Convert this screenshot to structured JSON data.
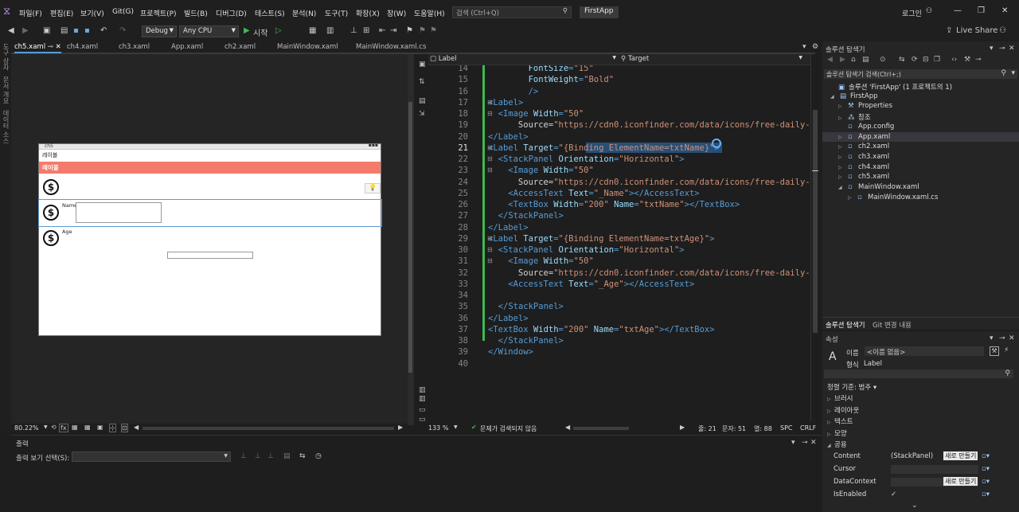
{
  "titlebar": {
    "menus": [
      "파일(F)",
      "편집(E)",
      "보기(V)",
      "Git(G)",
      "프로젝트(P)",
      "빌드(B)",
      "디버그(D)",
      "테스트(S)",
      "분석(N)",
      "도구(T)",
      "확장(X)",
      "창(W)",
      "도움말(H)"
    ],
    "search_placeholder": "검색 (Ctrl+Q)",
    "app_title": "FirstApp",
    "login": "로그인",
    "live_share": "Live Share"
  },
  "toolbar": {
    "config": "Debug",
    "platform": "Any CPU",
    "start_label": "시작"
  },
  "left_strip": [
    "도구 상자",
    "문서 개요",
    "데이터 소스"
  ],
  "doc_tabs": [
    "ch5.xaml",
    "ch4.xaml",
    "ch3.xaml",
    "App.xaml",
    "ch2.xaml",
    "MainWindow.xaml",
    "MainWindow.xaml.cs"
  ],
  "designer": {
    "window_title": "ch5",
    "label_text": "레이블",
    "header_text": "레이블",
    "name_label": "Name",
    "age_label": "Age",
    "zoom": "80.22%"
  },
  "editor": {
    "element_combo": "Label",
    "target_combo": "Target",
    "zoom": "133 %",
    "status_ok": "문제가 검색되지 않음",
    "line": "줄: 21",
    "col": "문자: 51",
    "col2": "열: 88",
    "spc": "SPC",
    "crlf": "CRLF",
    "lines": [
      {
        "n": "14",
        "code": "            FontSize=\"15\""
      },
      {
        "n": "15",
        "code": "            FontWeight=\"Bold\""
      },
      {
        "n": "16",
        "code": "            />"
      },
      {
        "n": "17",
        "code": "    <Label>"
      },
      {
        "n": "18",
        "code": "      <Image Width=\"50\""
      },
      {
        "n": "19",
        "code": "          Source=\"https://cdn0.iconfinder.com/data/icons/free-daily-icon"
      },
      {
        "n": "20",
        "code": "    </Label>"
      },
      {
        "n": "21",
        "code": "    <Label Target=\"{Binding ElementName=txtName}\">"
      },
      {
        "n": "22",
        "code": "      <StackPanel Orientation=\"Horizontal\">"
      },
      {
        "n": "23",
        "code": "        <Image Width=\"50\""
      },
      {
        "n": "24",
        "code": "          Source=\"https://cdn0.iconfinder.com/data/icons/free-daily-icon"
      },
      {
        "n": "25",
        "code": "        <AccessText Text=\"_Name\"></AccessText>"
      },
      {
        "n": "26",
        "code": "        <TextBox Width=\"200\" Name=\"txtName\"></TextBox>"
      },
      {
        "n": "27",
        "code": "      </StackPanel>"
      },
      {
        "n": "28",
        "code": "    </Label>"
      },
      {
        "n": "29",
        "code": "    <Label Target=\"{Binding ElementName=txtAge}\">"
      },
      {
        "n": "30",
        "code": "      <StackPanel Orientation=\"Horizontal\">"
      },
      {
        "n": "31",
        "code": "        <Image Width=\"50\""
      },
      {
        "n": "32",
        "code": "          Source=\"https://cdn0.iconfinder.com/data/icons/free-daily-icon"
      },
      {
        "n": "33",
        "code": "        <AccessText Text=\"_Age\"></AccessText>"
      },
      {
        "n": "34",
        "code": ""
      },
      {
        "n": "35",
        "code": "      </StackPanel>"
      },
      {
        "n": "36",
        "code": "    </Label>"
      },
      {
        "n": "37",
        "code": "    <TextBox Width=\"200\" Name=\"txtAge\"></TextBox>"
      },
      {
        "n": "38",
        "code": "  </StackPanel>"
      },
      {
        "n": "39",
        "code": "</Window>"
      },
      {
        "n": "40",
        "code": ""
      }
    ]
  },
  "solution": {
    "panel_title": "솔루션 탐색기",
    "search": "솔루션 탐색기 검색(Ctrl+;)",
    "items": [
      {
        "text": "솔루션 'FirstApp' (1 프로젝트의 1)"
      },
      {
        "text": "FirstApp"
      },
      {
        "text": "Properties"
      },
      {
        "text": "참조"
      },
      {
        "text": "App.config"
      },
      {
        "text": "App.xaml"
      },
      {
        "text": "ch2.xaml"
      },
      {
        "text": "ch3.xaml"
      },
      {
        "text": "ch4.xaml"
      },
      {
        "text": "ch5.xaml"
      },
      {
        "text": "MainWindow.xaml"
      },
      {
        "text": "MainWindow.xaml.cs"
      }
    ],
    "bottom_tabs": [
      "솔루션 탐색기",
      "Git 변경 내용"
    ]
  },
  "properties": {
    "panel_title": "속성",
    "name_label": "이름",
    "name_value": "<이름 없음>",
    "type_label": "형식",
    "type_value": "Label",
    "sort_label": "정렬 기준: 범주",
    "categories": [
      "브러시",
      "레이아웃",
      "텍스트",
      "모양",
      "공용"
    ],
    "rows": [
      {
        "name": "Content",
        "value": "(StackPanel)",
        "button": "새로 만들기"
      },
      {
        "name": "Cursor",
        "value": "",
        "button": ""
      },
      {
        "name": "DataContext",
        "value": "",
        "button": "새로 만들기"
      },
      {
        "name": "IsEnabled",
        "value": "✓",
        "button": ""
      }
    ]
  },
  "output": {
    "title": "출력",
    "select_label": "출력 보기 선택(S):"
  },
  "colors": {
    "accent": "#569cd6",
    "salmon_header": "#f47b6b",
    "modified_bar": "#3fb950"
  }
}
